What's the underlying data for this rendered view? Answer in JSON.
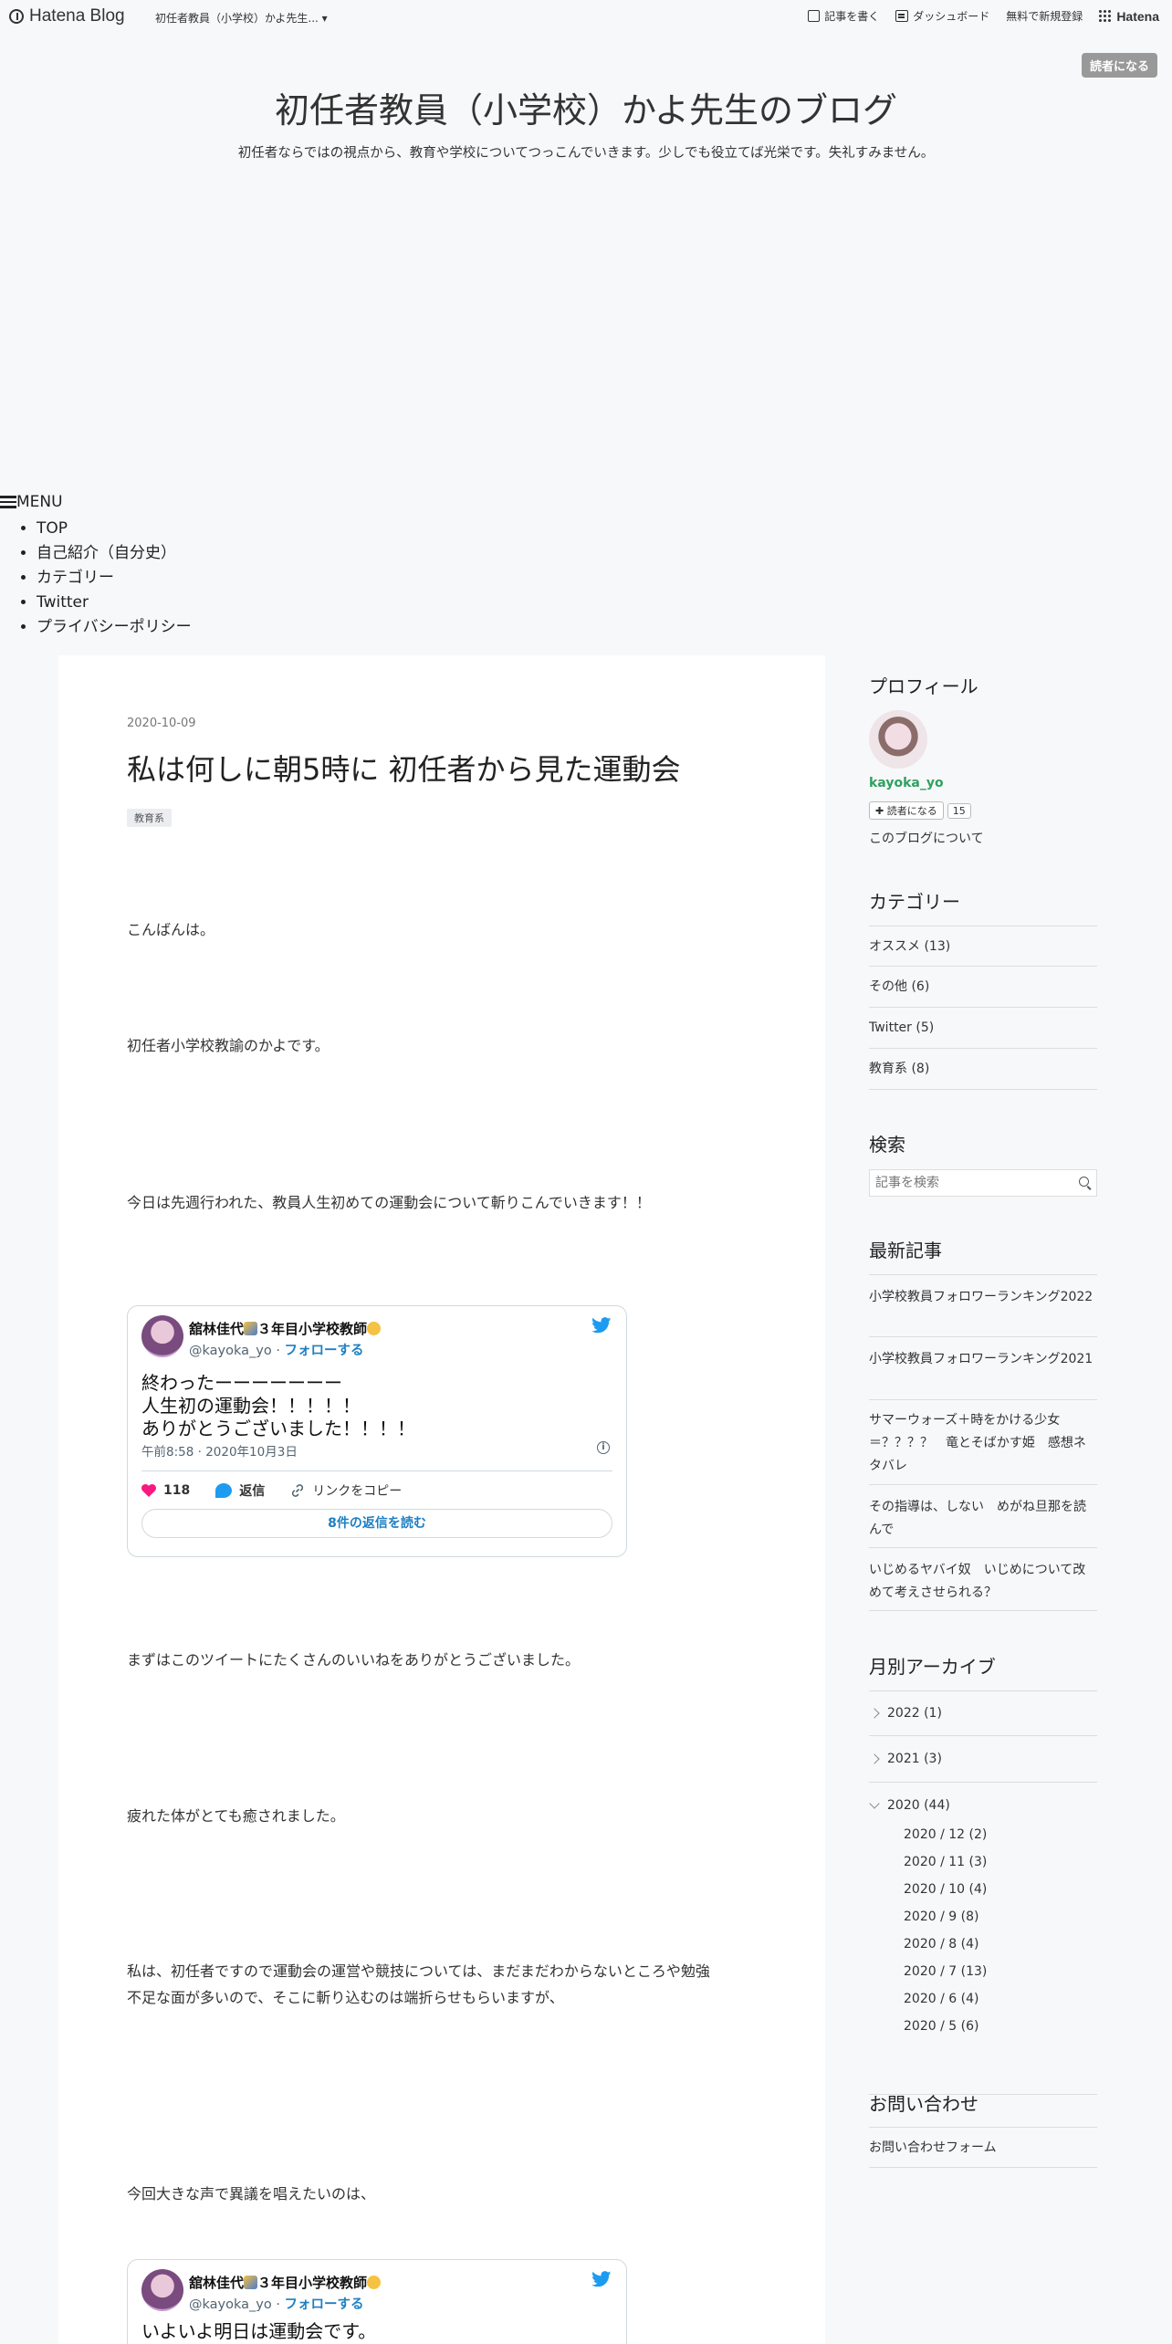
{
  "topbar": {
    "brand": "Hatena Blog",
    "blog_switch": "初任者教員（小学校）かよ先生... ▾",
    "write": "記事を書く",
    "dashboard": "ダッシュボード",
    "signup": "無料で新規登録",
    "hatena": "Hatena"
  },
  "subscribe_label": "読者になる",
  "blog": {
    "title": "初任者教員（小学校）かよ先生のブログ",
    "description": "初任者ならではの視点から、教育や学校についてつっこんでいきます。少しでも役立てば光栄です。失礼すみません。"
  },
  "menu": {
    "label": "MENU",
    "items": [
      "TOP",
      "自己紹介（自分史）",
      "カテゴリー",
      "Twitter",
      "プライバシーポリシー"
    ]
  },
  "post": {
    "date": "2020-10-09",
    "title": "私は何しに朝5時に 初任者から見た運動会",
    "tag": "教育系",
    "paragraphs": [
      "こんばんは。",
      "初任者小学校教諭のかよです。",
      "今日は先週行われた、教員人生初めての運動会について斬りこんでいきます！！",
      "まずはこのツイートにたくさんのいいねをありがとうございました。",
      "疲れた体がとても癒されました。",
      "私は、初任者ですので運動会の運営や競技については、まだまだわからないところや勉強",
      "不足な面が多いので、そこに斬り込むのは端折らせもらいますが、",
      "今回大きな声で異議を唱えたいのは、"
    ]
  },
  "tweet1": {
    "name": "舘林佳代",
    "name_suffix": "３年目小学校教師",
    "handle": "@kayoka_yo",
    "follow": "フォローする",
    "lines": [
      "終わったーーーーーーー",
      "人生初の運動会！！！！！",
      "ありがとうございました！！！！"
    ],
    "time": "午前8:58 · 2020年10月3日",
    "likes": "118",
    "reply": "返信",
    "copy": "リンクをコピー",
    "read_replies": "8件の返信を読む"
  },
  "tweet2": {
    "name": "舘林佳代",
    "name_suffix": "３年目小学校教師",
    "handle": "@kayoka_yo",
    "follow": "フォローする",
    "line": "いよいよ明日は運動会です。"
  },
  "sidebar": {
    "profile_heading": "プロフィール",
    "profile_name": "kayoka_yo",
    "subscribe": "読者になる",
    "subscriber_count": "15",
    "about": "このブログについて",
    "category_heading": "カテゴリー",
    "categories": [
      "オススメ (13)",
      "その他 (6)",
      "Twitter (5)",
      "教育系 (8)"
    ],
    "search_heading": "検索",
    "search_placeholder": "記事を検索",
    "recent_heading": "最新記事",
    "recent": [
      "小学校教員フォロワーランキング2022",
      "小学校教員フォロワーランキング2021",
      "サマーウォーズ＋時をかける少女＝？？？？　竜とそばかす姫　感想ネタバレ",
      "その指導は、しない　めがね旦那を読んで",
      "いじめるヤバイ奴　いじめについて改めて考えさせられる？"
    ],
    "archive_heading": "月別アーカイブ",
    "archive_years": [
      "2022 (1)",
      "2021 (3)",
      "2020 (44)"
    ],
    "archive_months": [
      "2020 / 12 (2)",
      "2020 / 11 (3)",
      "2020 / 10 (4)",
      "2020 / 9 (8)",
      "2020 / 8 (4)",
      "2020 / 7 (13)",
      "2020 / 6 (4)",
      "2020 / 5 (6)"
    ],
    "contact_heading": "お問い合わせ",
    "contact_form": "お問い合わせフォーム"
  }
}
